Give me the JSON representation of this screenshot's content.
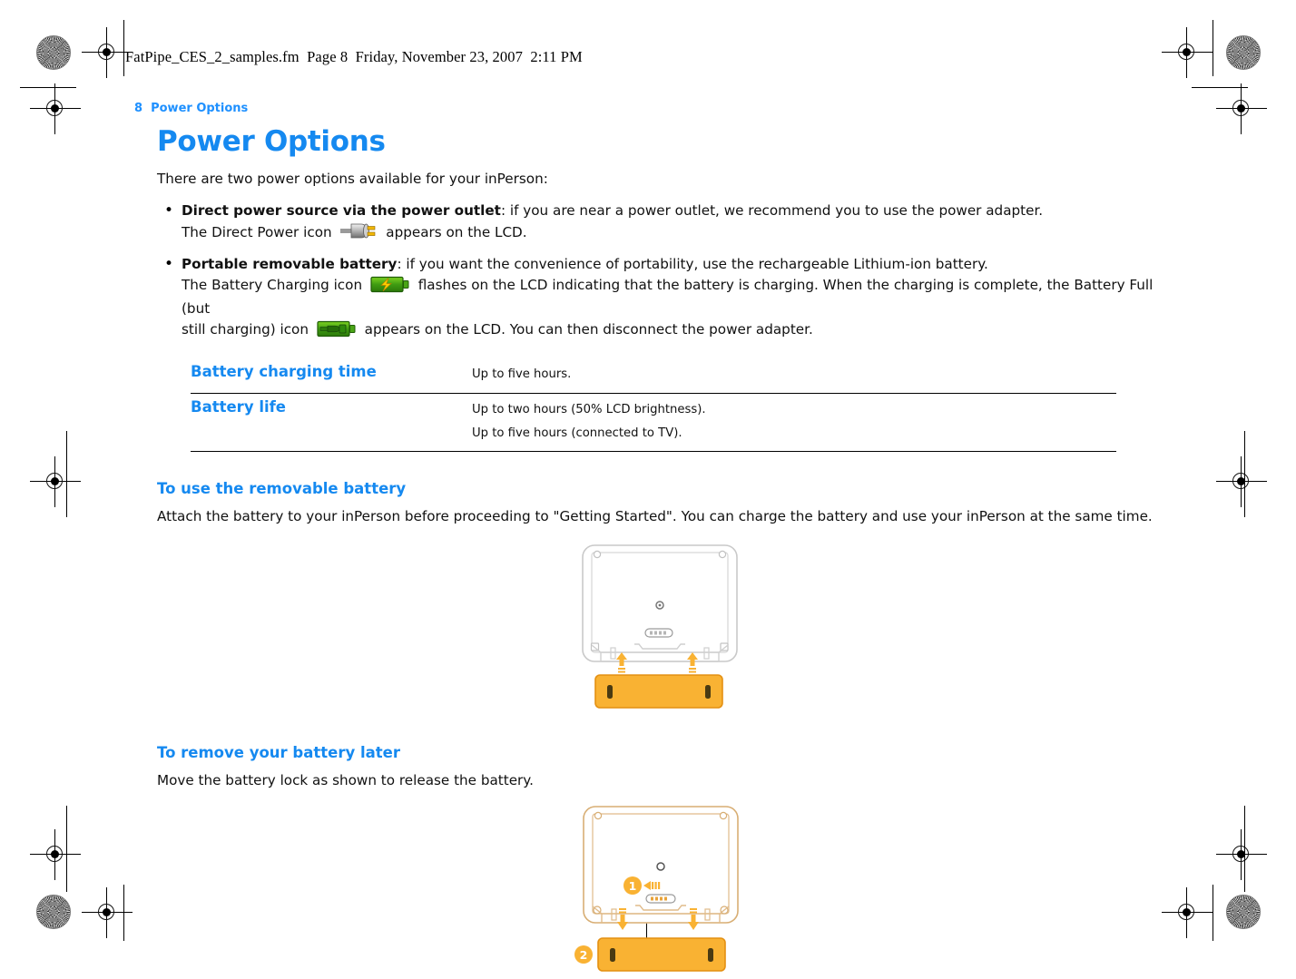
{
  "page": {
    "file_stamp": "FatPipe_CES_2_samples.fm  Page 8  Friday, November 23, 2007  2:11 PM",
    "running_head": "8  Power Options",
    "title": "Power Options",
    "intro": "There are two power options available for your inPerson:"
  },
  "colors": {
    "heading_blue": "#1589f0",
    "runhead_blue": "#1e90ff",
    "battery_orange": "#f9b233",
    "battery_orange_stroke": "#e8941a",
    "device_stroke": "#c8c8c8",
    "icon_green": "#3aa80a",
    "icon_bolt": "#ffcc00",
    "text_black": "#111111"
  },
  "bullets": [
    {
      "lead": "Direct power source via the power outlet",
      "text_after_lead": ": if you are near a power outlet, we recommend you to use the power adapter.",
      "line2_before_icon": "The Direct Power icon",
      "icon": "power-plug-icon",
      "line2_after_icon": "appears on the LCD."
    },
    {
      "lead": "Portable removable battery",
      "text_after_lead": ": if you want the convenience of portability, use the rechargeable Lithium-ion battery.",
      "line2_before_icon": "The Battery Charging icon",
      "icon_charging": "battery-charging-icon",
      "line2_mid": "flashes on the LCD indicating that the battery is charging. When the charging is complete, the Battery Full (but",
      "line3_before_icon": "still charging) icon",
      "icon_full": "battery-full-charging-icon",
      "line3_after_icon": "appears on the LCD. You can then disconnect the power adapter."
    }
  ],
  "spec_table": {
    "rows": [
      {
        "label": "Battery charging time",
        "values": [
          "Up to five hours."
        ]
      },
      {
        "label": "Battery life",
        "values": [
          "Up to two hours (50% LCD brightness).",
          "Up to five hours (connected to TV)."
        ]
      }
    ]
  },
  "sections": [
    {
      "heading": "To use the removable battery",
      "body": "Attach the battery to your inPerson before proceeding to \"Getting Started\". You can charge the battery and use your inPerson at the same time.",
      "figure": {
        "name": "attach-battery-diagram",
        "callouts": [],
        "arrow_direction": "up"
      }
    },
    {
      "heading": "To remove your battery later",
      "body": "Move the battery lock as shown to release the battery.",
      "figure": {
        "name": "remove-battery-diagram",
        "callouts": [
          "1",
          "2"
        ],
        "arrow_direction": "down"
      }
    }
  ]
}
